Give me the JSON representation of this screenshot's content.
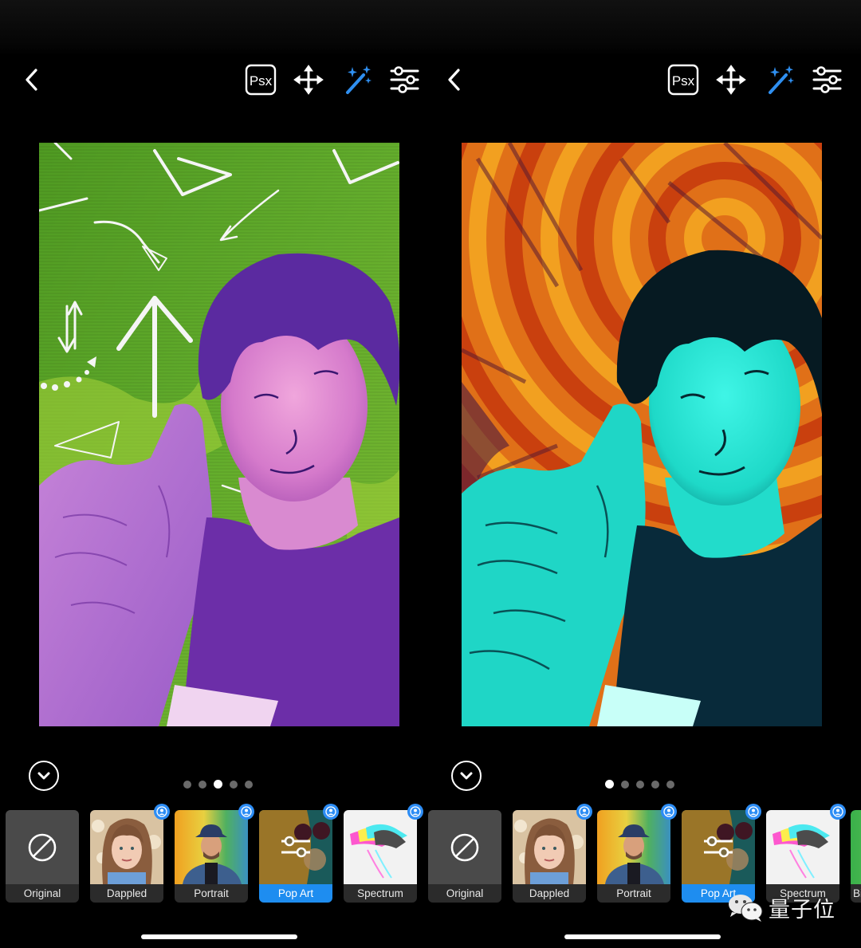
{
  "watermark": {
    "text": "量子位",
    "icon": "wechat-icon"
  },
  "screens": [
    {
      "side": "left",
      "toolbar": {
        "back_icon": "chevron-left-icon",
        "tools": [
          {
            "name": "psx",
            "label": "Psx",
            "icon": "psx-logo-icon"
          },
          {
            "name": "move",
            "icon": "move-arrows-icon"
          },
          {
            "name": "magic",
            "icon": "magic-wand-icon",
            "active": true
          },
          {
            "name": "adjust",
            "icon": "sliders-icon"
          }
        ]
      },
      "photo": {
        "description": "Pop Art filter result: purple-toned person on green background with white doodled arrows",
        "bg_color": "#5aa52a",
        "subject_color": "#8a3fc0"
      },
      "collapse_icon": "chevron-down-circle-icon",
      "page_dots": {
        "count": 5,
        "active_index": 2
      },
      "filters": [
        {
          "label": "Original",
          "icon": "no-effect-icon",
          "badge": false,
          "selected": false
        },
        {
          "label": "Dappled",
          "badge": true,
          "selected": false
        },
        {
          "label": "Portrait",
          "badge": true,
          "selected": false
        },
        {
          "label": "Pop Art",
          "badge": true,
          "selected": true,
          "overlay_icon": "sliders-icon"
        },
        {
          "label": "Spectrum",
          "badge": true,
          "selected": false
        }
      ]
    },
    {
      "side": "right",
      "toolbar": {
        "back_icon": "chevron-left-icon",
        "tools": [
          {
            "name": "psx",
            "label": "Psx",
            "icon": "psx-logo-icon"
          },
          {
            "name": "move",
            "icon": "move-arrows-icon"
          },
          {
            "name": "magic",
            "icon": "magic-wand-icon",
            "active": true
          },
          {
            "name": "adjust",
            "icon": "sliders-icon"
          }
        ]
      },
      "photo": {
        "description": "Pop Art filter result: cyan-toned person on orange and red striped background",
        "bg_color": "#e8741a",
        "subject_color": "#1fe0d0"
      },
      "collapse_icon": "chevron-down-circle-icon",
      "page_dots": {
        "count": 5,
        "active_index": 0
      },
      "filters": [
        {
          "label": "Original",
          "icon": "no-effect-icon",
          "badge": false,
          "selected": false
        },
        {
          "label": "Dappled",
          "badge": true,
          "selected": false
        },
        {
          "label": "Portrait",
          "badge": true,
          "selected": false
        },
        {
          "label": "Pop Art",
          "badge": true,
          "selected": true,
          "overlay_icon": "sliders-icon"
        },
        {
          "label": "Spectrum",
          "badge": true,
          "selected": false
        },
        {
          "label": "Bi",
          "badge": false,
          "selected": false
        }
      ]
    }
  ],
  "colors": {
    "accent": "#1e8df0",
    "badge": "#2d8df5",
    "magic_wand": "#2f8ff0",
    "tile_label_bg": "#2b2b2b",
    "original_tile_bg": "#4a4a4a"
  }
}
